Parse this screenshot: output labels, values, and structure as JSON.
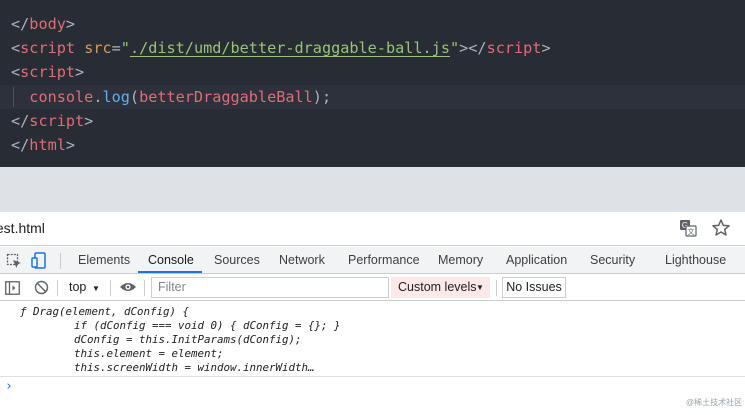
{
  "editor": {
    "line1": {
      "open": "</",
      "tag": "body",
      "close": ">"
    },
    "line2": {
      "open": "<",
      "tag": "script",
      "sp": " ",
      "attr": "src",
      "eq": "=",
      "q1": "\"",
      "src": "./dist/umd/better-draggable-ball.js",
      "q2": "\"",
      "gt": ">",
      "end_open": "</",
      "end_tag": "script",
      "end_close": ">"
    },
    "line3": {
      "open": "<",
      "tag": "script",
      "close": ">"
    },
    "line4": {
      "indent": "  ",
      "obj": "console",
      "dot": ".",
      "fn": "log",
      "lp": "(",
      "arg": "betterDraggableBall",
      "rp": ");"
    },
    "line5": {
      "open": "</",
      "tag": "script",
      "close": ">"
    },
    "line6": {
      "open": "</",
      "tag": "html",
      "close": ">"
    }
  },
  "browser": {
    "tab_title": "test.html",
    "translate_icon": "translate-icon",
    "star_icon": "bookmark-star-icon"
  },
  "devtools": {
    "tabs": [
      "Elements",
      "Console",
      "Sources",
      "Network",
      "Performance",
      "Memory",
      "Application",
      "Security",
      "Lighthouse"
    ],
    "active_tab": "Console",
    "accent": "#1a73e8"
  },
  "toolbar": {
    "context": "top",
    "filter_placeholder": "Filter",
    "levels_label": "Custom levels",
    "issues_label": "No Issues"
  },
  "console": {
    "lines": [
      "ƒ Drag(element, dConfig) {",
      "if (dConfig === void 0) { dConfig = {}; }",
      "dConfig = this.InitParams(dConfig);",
      "this.element = element;",
      "this.screenWidth = window.innerWidth…"
    ],
    "prompt": "›"
  },
  "watermark": "@稀土技术社区"
}
